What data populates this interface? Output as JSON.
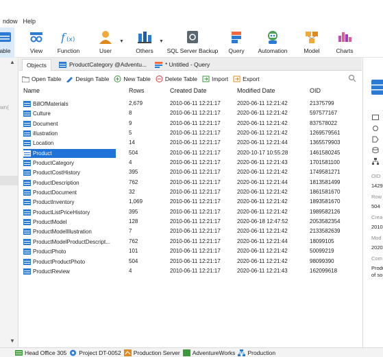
{
  "menu": [
    "ndow",
    "Help"
  ],
  "toolbar": {
    "items": [
      {
        "label": "able",
        "icon": "table-icon",
        "selected": true
      },
      {
        "label": "View",
        "icon": "view-icon"
      },
      {
        "label": "Function",
        "icon": "function-icon"
      },
      {
        "label": "User",
        "icon": "user-icon"
      },
      {
        "label": "Others",
        "icon": "others-icon"
      },
      {
        "label": "SQL Server Backup",
        "icon": "backup-icon"
      },
      {
        "label": "Query",
        "icon": "query-icon"
      },
      {
        "label": "Automation",
        "icon": "automation-icon"
      },
      {
        "label": "Model",
        "icon": "model-icon"
      },
      {
        "label": "Charts",
        "icon": "charts-icon"
      }
    ]
  },
  "tabs": {
    "objects": "Objects",
    "product_category": "ProductCategory @Adventu...",
    "untitled_query": "* Untitled - Query"
  },
  "objbar": {
    "open_table": "Open Table",
    "design_table": "Design Table",
    "new_table": "New Table",
    "delete_table": "Delete Table",
    "import": "Import",
    "export": "Export"
  },
  "columns": {
    "name": "Name",
    "rows": "Rows",
    "created": "Created Date",
    "modified": "Modified Date",
    "oid": "OID"
  },
  "tables": [
    {
      "name": "BillOfMaterials",
      "rows": "2,679",
      "created": "2010-06-11 12:21:17",
      "modified": "2020-06-11 12:21:42",
      "oid": "21375799"
    },
    {
      "name": "Culture",
      "rows": "8",
      "created": "2010-06-11 12:21:17",
      "modified": "2020-06-11 12:21:42",
      "oid": "597577167"
    },
    {
      "name": "Document",
      "rows": "9",
      "created": "2010-06-11 12:21:17",
      "modified": "2020-06-11 12:21:42",
      "oid": "837578022"
    },
    {
      "name": "illustration",
      "rows": "5",
      "created": "2010-06-11 12:21:17",
      "modified": "2020-06-11 12:21:42",
      "oid": "1269579561"
    },
    {
      "name": "Location",
      "rows": "14",
      "created": "2010-06-11 12:21:17",
      "modified": "2020-06-11 12:21:44",
      "oid": "1365579903"
    },
    {
      "name": "Product",
      "rows": "504",
      "created": "2010-06-11 12:21:17",
      "modified": "2020-10-17 10:55:28",
      "oid": "1461580245",
      "selected": true
    },
    {
      "name": "ProductCategory",
      "rows": "4",
      "created": "2010-06-11 12:21:17",
      "modified": "2020-06-11 12:21:43",
      "oid": "1701581100"
    },
    {
      "name": "ProductCostHistory",
      "rows": "395",
      "created": "2010-06-11 12:21:17",
      "modified": "2020-06-11 12:21:42",
      "oid": "1749581271"
    },
    {
      "name": "ProductDescription",
      "rows": "762",
      "created": "2010-06-11 12:21:17",
      "modified": "2020-06-11 12:21:44",
      "oid": "1813581499"
    },
    {
      "name": "ProductDocument",
      "rows": "32",
      "created": "2010-06-11 12:21:17",
      "modified": "2020-06-11 12:21:42",
      "oid": "1861581670"
    },
    {
      "name": "ProductInventory",
      "rows": "1,069",
      "created": "2010-06-11 12:21:17",
      "modified": "2020-06-11 12:21:42",
      "oid": "1893581670"
    },
    {
      "name": "ProductListPriceHistory",
      "rows": "395",
      "created": "2010-06-11 12:21:17",
      "modified": "2020-06-11 12:21:42",
      "oid": "1989582126"
    },
    {
      "name": "ProductModel",
      "rows": "128",
      "created": "2010-06-11 12:21:17",
      "modified": "2020-06-18 12:47:52",
      "oid": "2053582354"
    },
    {
      "name": "ProductModelIllustration",
      "rows": "7",
      "created": "2010-06-11 12:21:17",
      "modified": "2020-06-11 12:21:42",
      "oid": "2133582639"
    },
    {
      "name": "ProductModelProductDescript...",
      "rows": "762",
      "created": "2010-06-11 12:21:17",
      "modified": "2020-06-11 12:21:44",
      "oid": "18099105"
    },
    {
      "name": "ProductPhoto",
      "rows": "101",
      "created": "2010-06-11 12:21:17",
      "modified": "2020-06-11 12:21:42",
      "oid": "50099219"
    },
    {
      "name": "ProductProductPhoto",
      "rows": "504",
      "created": "2010-06-11 12:21:17",
      "modified": "2020-06-11 12:21:42",
      "oid": "98099390"
    },
    {
      "name": "ProductReview",
      "rows": "4",
      "created": "2010-06-11 12:21:17",
      "modified": "2020-06-11 12:21:43",
      "oid": "162099618"
    }
  ],
  "leftnav": {
    "ghost": "wn("
  },
  "rightpanel": {
    "oid_label": "OID",
    "oid_value": "1429",
    "rows_label": "Row",
    "rows_value": "504",
    "created_label": "Crea",
    "created_value": "2010",
    "modified_label": "Mod",
    "modified_value": "2020",
    "comment_label": "Com",
    "comment_line1": "Produ",
    "comment_line2": "of so"
  },
  "status": {
    "conn": "Head Office 305",
    "project": "Project DT-0052",
    "server": "Production Server",
    "db": "AdventureWorks",
    "schema": "Production"
  },
  "colors": {
    "accent": "#1f73d8",
    "selection_bg": "#dbeaf8"
  }
}
